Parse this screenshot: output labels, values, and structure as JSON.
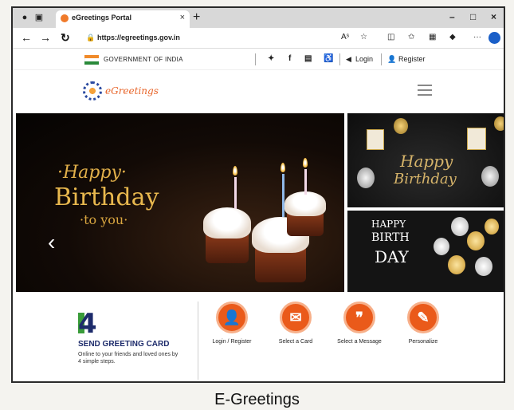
{
  "browser": {
    "tab_title": "eGreetings Portal",
    "tab_close": "×",
    "new_tab": "+",
    "url": "https://egreetings.gov.in",
    "read_aloud": "Aˢ",
    "window_min": "–",
    "window_max": "□",
    "window_close": "×",
    "more": "···"
  },
  "gov_bar": {
    "gov_text": "GOVERNMENT OF INDIA",
    "login": "Login",
    "register": "Register"
  },
  "site": {
    "logo_text": "eGreetings"
  },
  "hero": {
    "line1": "·Happy·",
    "line2": "Birthday",
    "line3": "·to you·",
    "prev_arrow": "‹"
  },
  "side_banners": {
    "top_line1": "Happy",
    "top_line2": "Birthday",
    "bottom_line1": "HAPPY",
    "bottom_line2": "BIRTH",
    "bottom_line3": "DAY"
  },
  "steps": {
    "count": "4",
    "heading": "SEND GREETING CARD",
    "description": "Online to your friends and loved ones by 4 simple steps.",
    "items": [
      {
        "label": "Login / Register",
        "icon": "user-icon",
        "glyph": "👤"
      },
      {
        "label": "Select a Card",
        "icon": "envelope-icon",
        "glyph": "✉"
      },
      {
        "label": "Select a Message",
        "icon": "quote-icon",
        "glyph": "❞"
      },
      {
        "label": "Personalize",
        "icon": "edit-icon",
        "glyph": "✎"
      }
    ]
  },
  "caption": "E-Greetings",
  "colors": {
    "accent": "#ea5a1a",
    "navy": "#1d2b6b",
    "gold": "#e2b04a"
  }
}
